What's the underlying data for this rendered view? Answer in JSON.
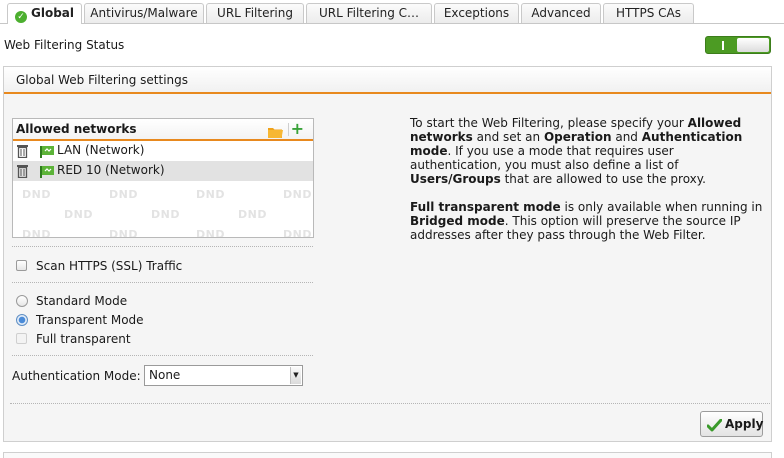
{
  "tabs": [
    {
      "label": "Global",
      "active": true
    },
    {
      "label": "Antivirus/Malware"
    },
    {
      "label": "URL Filtering"
    },
    {
      "label": "URL Filtering C…"
    },
    {
      "label": "Exceptions"
    },
    {
      "label": "Advanced"
    },
    {
      "label": "HTTPS CAs"
    }
  ],
  "status": {
    "label": "Web Filtering Status",
    "enabled": true
  },
  "panel": {
    "title": "Global Web Filtering settings",
    "networks": {
      "header": "Allowed networks",
      "items": [
        {
          "label": "LAN (Network)"
        },
        {
          "label": "RED 10 (Network)"
        }
      ],
      "dnd_text": "DND"
    },
    "scan_https": {
      "label": "Scan HTTPS (SSL) Traffic",
      "checked": false
    },
    "modes": [
      {
        "label": "Standard Mode",
        "checked": false
      },
      {
        "label": "Transparent Mode",
        "checked": true
      },
      {
        "label": "Full transparent",
        "checked": false,
        "disabled": true
      }
    ],
    "auth": {
      "label": "Authentication Mode:",
      "value": "None"
    },
    "info": {
      "p1_a": "To start the Web Filtering, please specify your ",
      "p1_b": "Allowed networks",
      "p1_c": " and set an ",
      "p1_d": "Operation",
      "p1_e": " and ",
      "p1_f": "Authentication mode",
      "p1_g": ". If you use a mode that requires user authentication, you must also define a list of ",
      "p1_h": "Users/Groups",
      "p1_i": " that are allowed to use the proxy.",
      "p2_a": "Full transparent mode",
      "p2_b": " is only available when running in ",
      "p2_c": "Bridged mode",
      "p2_d": ". This option will preserve the source IP addresses after they pass through the Web Filter."
    },
    "apply_label": "Apply"
  },
  "colors": {
    "accent": "#e8891e",
    "toggle_on": "#4c9b23",
    "ok_green": "#4caf2f"
  }
}
